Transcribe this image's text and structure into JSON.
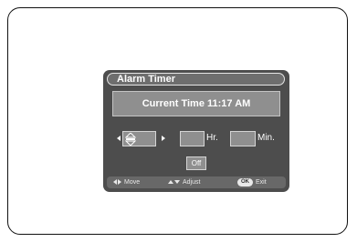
{
  "dialog": {
    "title": "Alarm Timer",
    "current_time": "Current Time 11:17 AM"
  },
  "fields": {
    "hour_label": "Hr.",
    "minute_label": "Min.",
    "off_label": "Off"
  },
  "footer": {
    "move_label": "Move",
    "adjust_label": "Adjust",
    "ok_badge": "OK",
    "exit_label": "Exit"
  },
  "colors": {
    "panel": "#4d4d4d",
    "field": "#8f8f8f",
    "text": "#ffffff"
  }
}
